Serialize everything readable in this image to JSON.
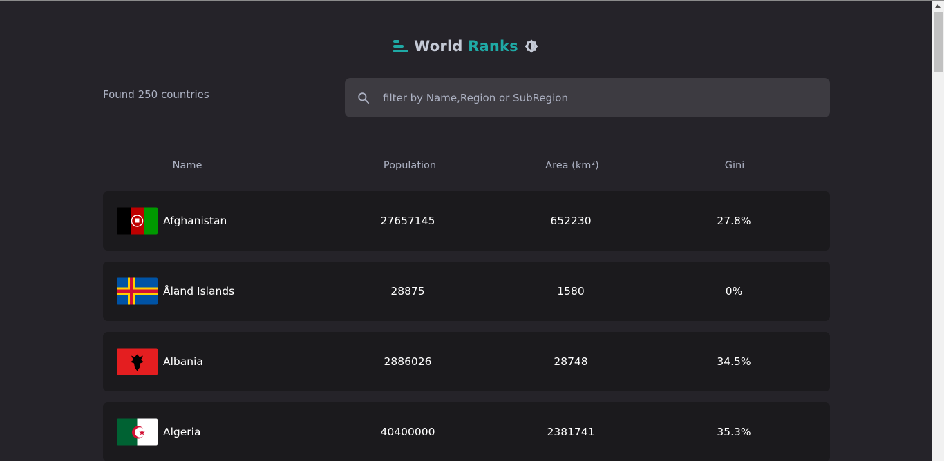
{
  "header": {
    "title_part1": "World",
    "title_part2": "Ranks",
    "logo_icon": "bar-chart-icon",
    "theme_toggle_icon": "brightness-icon"
  },
  "toolbar": {
    "count_text": "Found 250 countries",
    "search_placeholder": "filter by Name,Region or SubRegion",
    "search_value": "",
    "search_icon": "search-icon"
  },
  "table": {
    "columns": [
      "Name",
      "Population",
      "Area (km²)",
      "Gini"
    ],
    "rows": [
      {
        "name": "Afghanistan",
        "population": "27657145",
        "area": "652230",
        "gini": "27.8%",
        "flag": "flag-afghanistan"
      },
      {
        "name": "Åland Islands",
        "population": "28875",
        "area": "1580",
        "gini": "0%",
        "flag": "flag-aland"
      },
      {
        "name": "Albania",
        "population": "2886026",
        "area": "28748",
        "gini": "34.5%",
        "flag": "flag-albania"
      },
      {
        "name": "Algeria",
        "population": "40400000",
        "area": "2381741",
        "gini": "35.3%",
        "flag": "flag-algeria"
      }
    ]
  },
  "colors": {
    "background": "#252329",
    "row_background": "#1b1a1d",
    "search_background": "#3d3b41",
    "accent": "#1fa9a5",
    "text_muted": "#acb1c2",
    "text_primary": "#ffffff"
  }
}
